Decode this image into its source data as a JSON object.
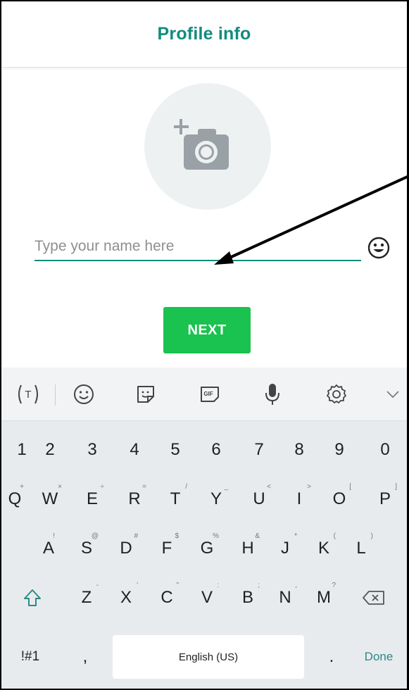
{
  "header": {
    "title": "Profile info"
  },
  "profile": {
    "photo_icon": "add-camera-icon",
    "name_placeholder": "Type your name here",
    "name_value": "",
    "emoji_icon": "emoji-icon",
    "next_label": "NEXT"
  },
  "colors": {
    "accent": "#128c7e",
    "next_button": "#1ac24f",
    "keyboard_bg": "#e8ebee"
  },
  "keyboard": {
    "toolbar": [
      {
        "icon": "text-cursor-icon"
      },
      {
        "icon": "smiley-icon"
      },
      {
        "icon": "sticker-icon"
      },
      {
        "icon": "gif-icon"
      },
      {
        "icon": "microphone-icon"
      },
      {
        "icon": "settings-icon"
      },
      {
        "icon": "chevron-down-icon"
      }
    ],
    "row_numbers": [
      "1",
      "2",
      "3",
      "4",
      "5",
      "6",
      "7",
      "8",
      "9",
      "0"
    ],
    "row_1": [
      {
        "k": "Q",
        "h": "+"
      },
      {
        "k": "W",
        "h": "×"
      },
      {
        "k": "E",
        "h": "÷"
      },
      {
        "k": "R",
        "h": "="
      },
      {
        "k": "T",
        "h": "/"
      },
      {
        "k": "Y",
        "h": "_"
      },
      {
        "k": "U",
        "h": "<"
      },
      {
        "k": "I",
        "h": ">"
      },
      {
        "k": "O",
        "h": "["
      },
      {
        "k": "P",
        "h": "]"
      }
    ],
    "row_2": [
      {
        "k": "A",
        "h": "!"
      },
      {
        "k": "S",
        "h": "@"
      },
      {
        "k": "D",
        "h": "#"
      },
      {
        "k": "F",
        "h": "$"
      },
      {
        "k": "G",
        "h": "%"
      },
      {
        "k": "H",
        "h": "&"
      },
      {
        "k": "J",
        "h": "*"
      },
      {
        "k": "K",
        "h": "("
      },
      {
        "k": "L",
        "h": ")"
      }
    ],
    "row_3": [
      {
        "k": "Z",
        "h": "-"
      },
      {
        "k": "X",
        "h": "'"
      },
      {
        "k": "C",
        "h": "\""
      },
      {
        "k": "V",
        "h": ":"
      },
      {
        "k": "B",
        "h": ";"
      },
      {
        "k": "N",
        "h": ","
      },
      {
        "k": "M",
        "h": "?"
      }
    ],
    "shift_icon": "shift-icon",
    "backspace_icon": "backspace-icon",
    "symbols_label": "!#1",
    "comma_label": ",",
    "space_label": "English (US)",
    "period_label": ".",
    "done_label": "Done"
  }
}
